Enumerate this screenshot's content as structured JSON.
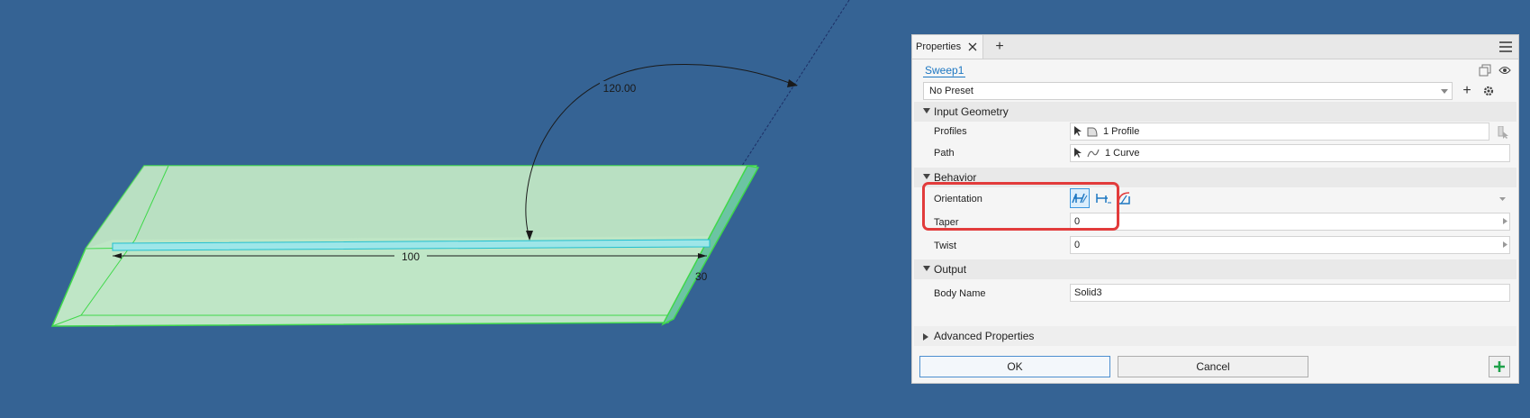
{
  "viewport": {
    "dimension_length": "100",
    "dimension_angle": "120.00",
    "dimension_partial": "30"
  },
  "panel": {
    "tab_label": "Properties",
    "feature_name": "Sweep1",
    "preset_value": "No Preset",
    "sections": {
      "input_geometry": "Input Geometry",
      "behavior": "Behavior",
      "output": "Output",
      "advanced": "Advanced Properties"
    },
    "fields": {
      "profiles_label": "Profiles",
      "profiles_value": "1 Profile",
      "path_label": "Path",
      "path_value": "1 Curve",
      "orientation_label": "Orientation",
      "taper_label": "Taper",
      "taper_value": "0",
      "twist_label": "Twist",
      "twist_value": "0",
      "body_name_label": "Body Name",
      "body_name_value": "Solid3"
    },
    "buttons": {
      "ok": "OK",
      "cancel": "Cancel"
    }
  },
  "colors": {
    "background": "#356394",
    "solid_fill": "#bfe6c6",
    "edge": "#3fd84a",
    "accent": "#1d77c2",
    "highlight": "#e23b3b",
    "apply": "#1fa14a"
  },
  "icons": {
    "orientation_options": [
      "path-orientation-icon",
      "fixed-orientation-icon",
      "guide-orientation-icon"
    ]
  }
}
